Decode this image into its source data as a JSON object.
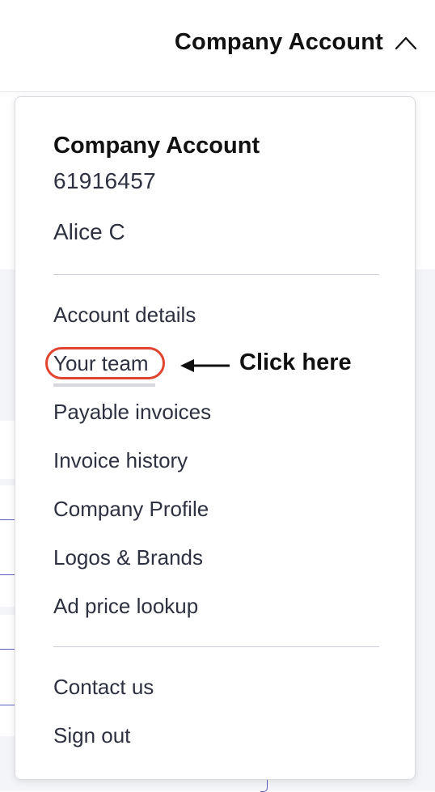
{
  "header": {
    "account_label": "Company Account",
    "chevron_icon": "chevron-up-icon"
  },
  "dropdown": {
    "title": "Company Account",
    "account_number": "61916457",
    "user_name": "Alice C",
    "menu_items": [
      "Account details",
      "Your team",
      "Payable invoices",
      "Invoice history",
      "Company Profile",
      "Logos & Brands",
      "Ad price lookup"
    ],
    "footer_items": [
      "Contact us",
      "Sign out"
    ]
  },
  "annotation": {
    "text": "Click here",
    "arrow_icon": "arrow-left-icon",
    "highlight_color": "#e0442e"
  }
}
